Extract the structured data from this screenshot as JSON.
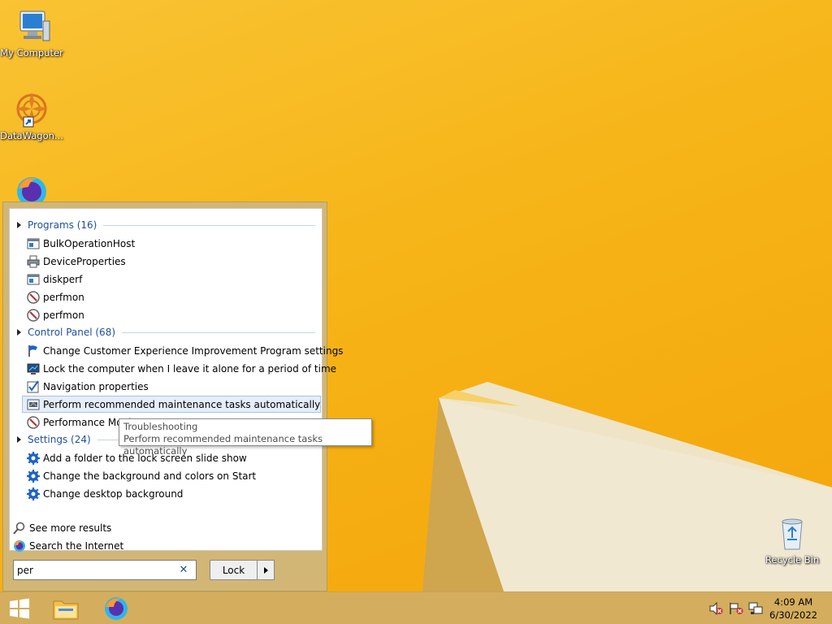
{
  "desktop": {
    "icons": [
      {
        "label": "My Computer",
        "icon": "computer-icon"
      },
      {
        "label": "DataWagon...",
        "icon": "datawagon-icon"
      },
      {
        "label": "",
        "icon": "firefox-icon"
      },
      {
        "label": "Recycle Bin",
        "icon": "recycle-bin-icon"
      }
    ]
  },
  "search": {
    "groups": {
      "programs": {
        "label": "Programs (16)"
      },
      "control_panel": {
        "label": "Control Panel (68)"
      },
      "settings": {
        "label": "Settings (24)"
      }
    },
    "programs": [
      {
        "label": "BulkOperationHost",
        "icon": "app-window-icon"
      },
      {
        "label": "DeviceProperties",
        "icon": "printer-icon"
      },
      {
        "label": "diskperf",
        "icon": "app-window-icon"
      },
      {
        "label": "perfmon",
        "icon": "perfmon-gauge-icon"
      },
      {
        "label": "perfmon",
        "icon": "perfmon-gauge-icon"
      }
    ],
    "control_panel": [
      {
        "label": "Change Customer Experience Improvement Program settings",
        "icon": "flag-icon"
      },
      {
        "label": "Lock the computer when I leave it alone for a period of time",
        "icon": "monitor-icon"
      },
      {
        "label": "Navigation properties",
        "icon": "checkbox-icon"
      },
      {
        "label": "Perform recommended maintenance tasks automatically",
        "icon": "maintenance-icon"
      },
      {
        "label": "Performance Monitor",
        "icon": "perfmon-gauge-icon"
      }
    ],
    "settings": [
      {
        "label": "Add a folder to the lock screen slide show",
        "icon": "gear-icon"
      },
      {
        "label": "Change the background and colors on Start",
        "icon": "gear-icon"
      },
      {
        "label": "Change desktop background",
        "icon": "gear-icon"
      }
    ],
    "footer": {
      "see_more": "See more results",
      "search_internet": "Search the Internet"
    },
    "query": "per",
    "clear_glyph": "✕",
    "lock_label": "Lock"
  },
  "tooltip": {
    "line1": "Troubleshooting",
    "line2": "Perform recommended maintenance tasks automatically"
  },
  "taskbar": {
    "time": "4:09 AM",
    "date": "6/30/2022"
  }
}
